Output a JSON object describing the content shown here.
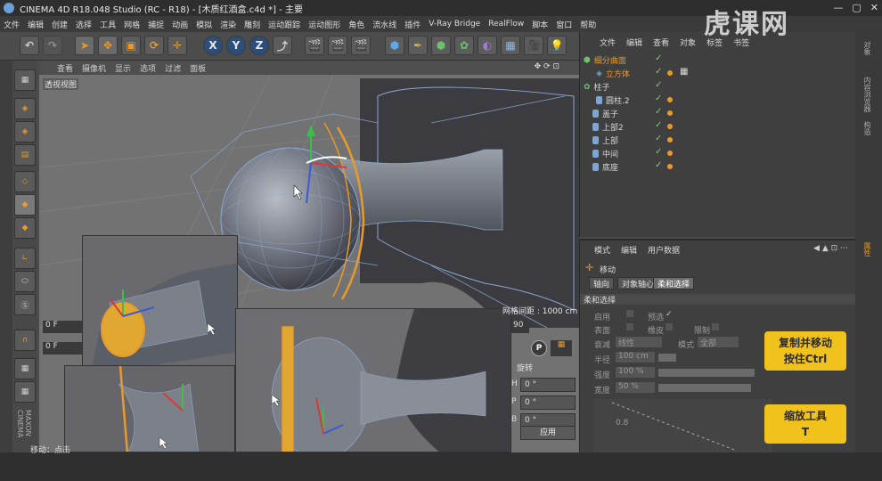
{
  "app": {
    "title": "CINEMA 4D R18.048 Studio (RC - R18) - [木质红酒盒.c4d *] - 主要",
    "window_buttons": [
      "—",
      "▢",
      "✕"
    ]
  },
  "menubar": [
    "文件",
    "编辑",
    "创建",
    "选择",
    "工具",
    "网格",
    "捕捉",
    "动画",
    "模拟",
    "渲染",
    "雕刻",
    "运动跟踪",
    "运动图形",
    "角色",
    "流水线",
    "插件",
    "V-Ray Bridge",
    "RealFlow",
    "脚本",
    "窗口",
    "帮助"
  ],
  "toolbar": {
    "axis_buttons": [
      "X",
      "Y",
      "Z"
    ]
  },
  "viewport": {
    "menu": [
      "查看",
      "摄像机",
      "显示",
      "选项",
      "过滤",
      "面板"
    ],
    "label": "透视视图",
    "grid_distance": "网格间距 : 1000 cm"
  },
  "object_manager": {
    "menu": [
      "文件",
      "编辑",
      "查看",
      "对象",
      "标签",
      "书签"
    ],
    "rows": [
      {
        "name": "细分曲面",
        "color": "#e89a2a"
      },
      {
        "name": "立方体",
        "color": "#e89a2a"
      },
      {
        "name": "柱子",
        "color": "#d8d8d8"
      },
      {
        "name": "圆柱.2",
        "color": "#d8d8d8"
      },
      {
        "name": "盖子",
        "color": "#d8d8d8"
      },
      {
        "name": "上部2",
        "color": "#d8d8d8"
      },
      {
        "name": "上部",
        "color": "#d8d8d8"
      },
      {
        "name": "中间",
        "color": "#d8d8d8"
      },
      {
        "name": "底座",
        "color": "#d8d8d8"
      }
    ]
  },
  "attributes": {
    "menu": [
      "模式",
      "编辑",
      "用户数据"
    ],
    "mode_title": "移动",
    "tabs": [
      "轴向",
      "对象轴心",
      "柔和选择"
    ],
    "active_tab": "柔和选择",
    "section": "柔和选择",
    "fields": {
      "enable": "启用",
      "preview": "预选",
      "surface": "表面",
      "rubber": "橡皮",
      "limit": "限制",
      "mode": "模式",
      "mode_value": "全部",
      "falloff": "衰减",
      "falloff_value": "线性",
      "radius": "半径",
      "radius_value": "100 cm",
      "strength": "强度",
      "strength_value": "100 %",
      "width": "宽度",
      "width_value": "50 %",
      "graph_tick": "0.8"
    }
  },
  "coords": {
    "rotation_label": "旋转",
    "h": "H",
    "h_val": "0 °",
    "p": "P",
    "p_val": "0 °",
    "b": "B",
    "b_val": "0 °",
    "apply": "应用",
    "frame_val": "90",
    "frame_f": "0 F",
    "frame_f2": "0 F"
  },
  "right_tabs": [
    "对象",
    "内容浏览器",
    "构造",
    "属性"
  ],
  "status": "移动：点击",
  "tips": [
    {
      "line1": "复制并移动",
      "line2": "按住Ctrl"
    },
    {
      "line1": "缩放工具",
      "line2": "T"
    }
  ],
  "watermark": "虎课网",
  "colors": {
    "accent_orange": "#e89a2a",
    "selection_blue": "#3a6fa8",
    "tip_yellow": "#f2c21c"
  }
}
